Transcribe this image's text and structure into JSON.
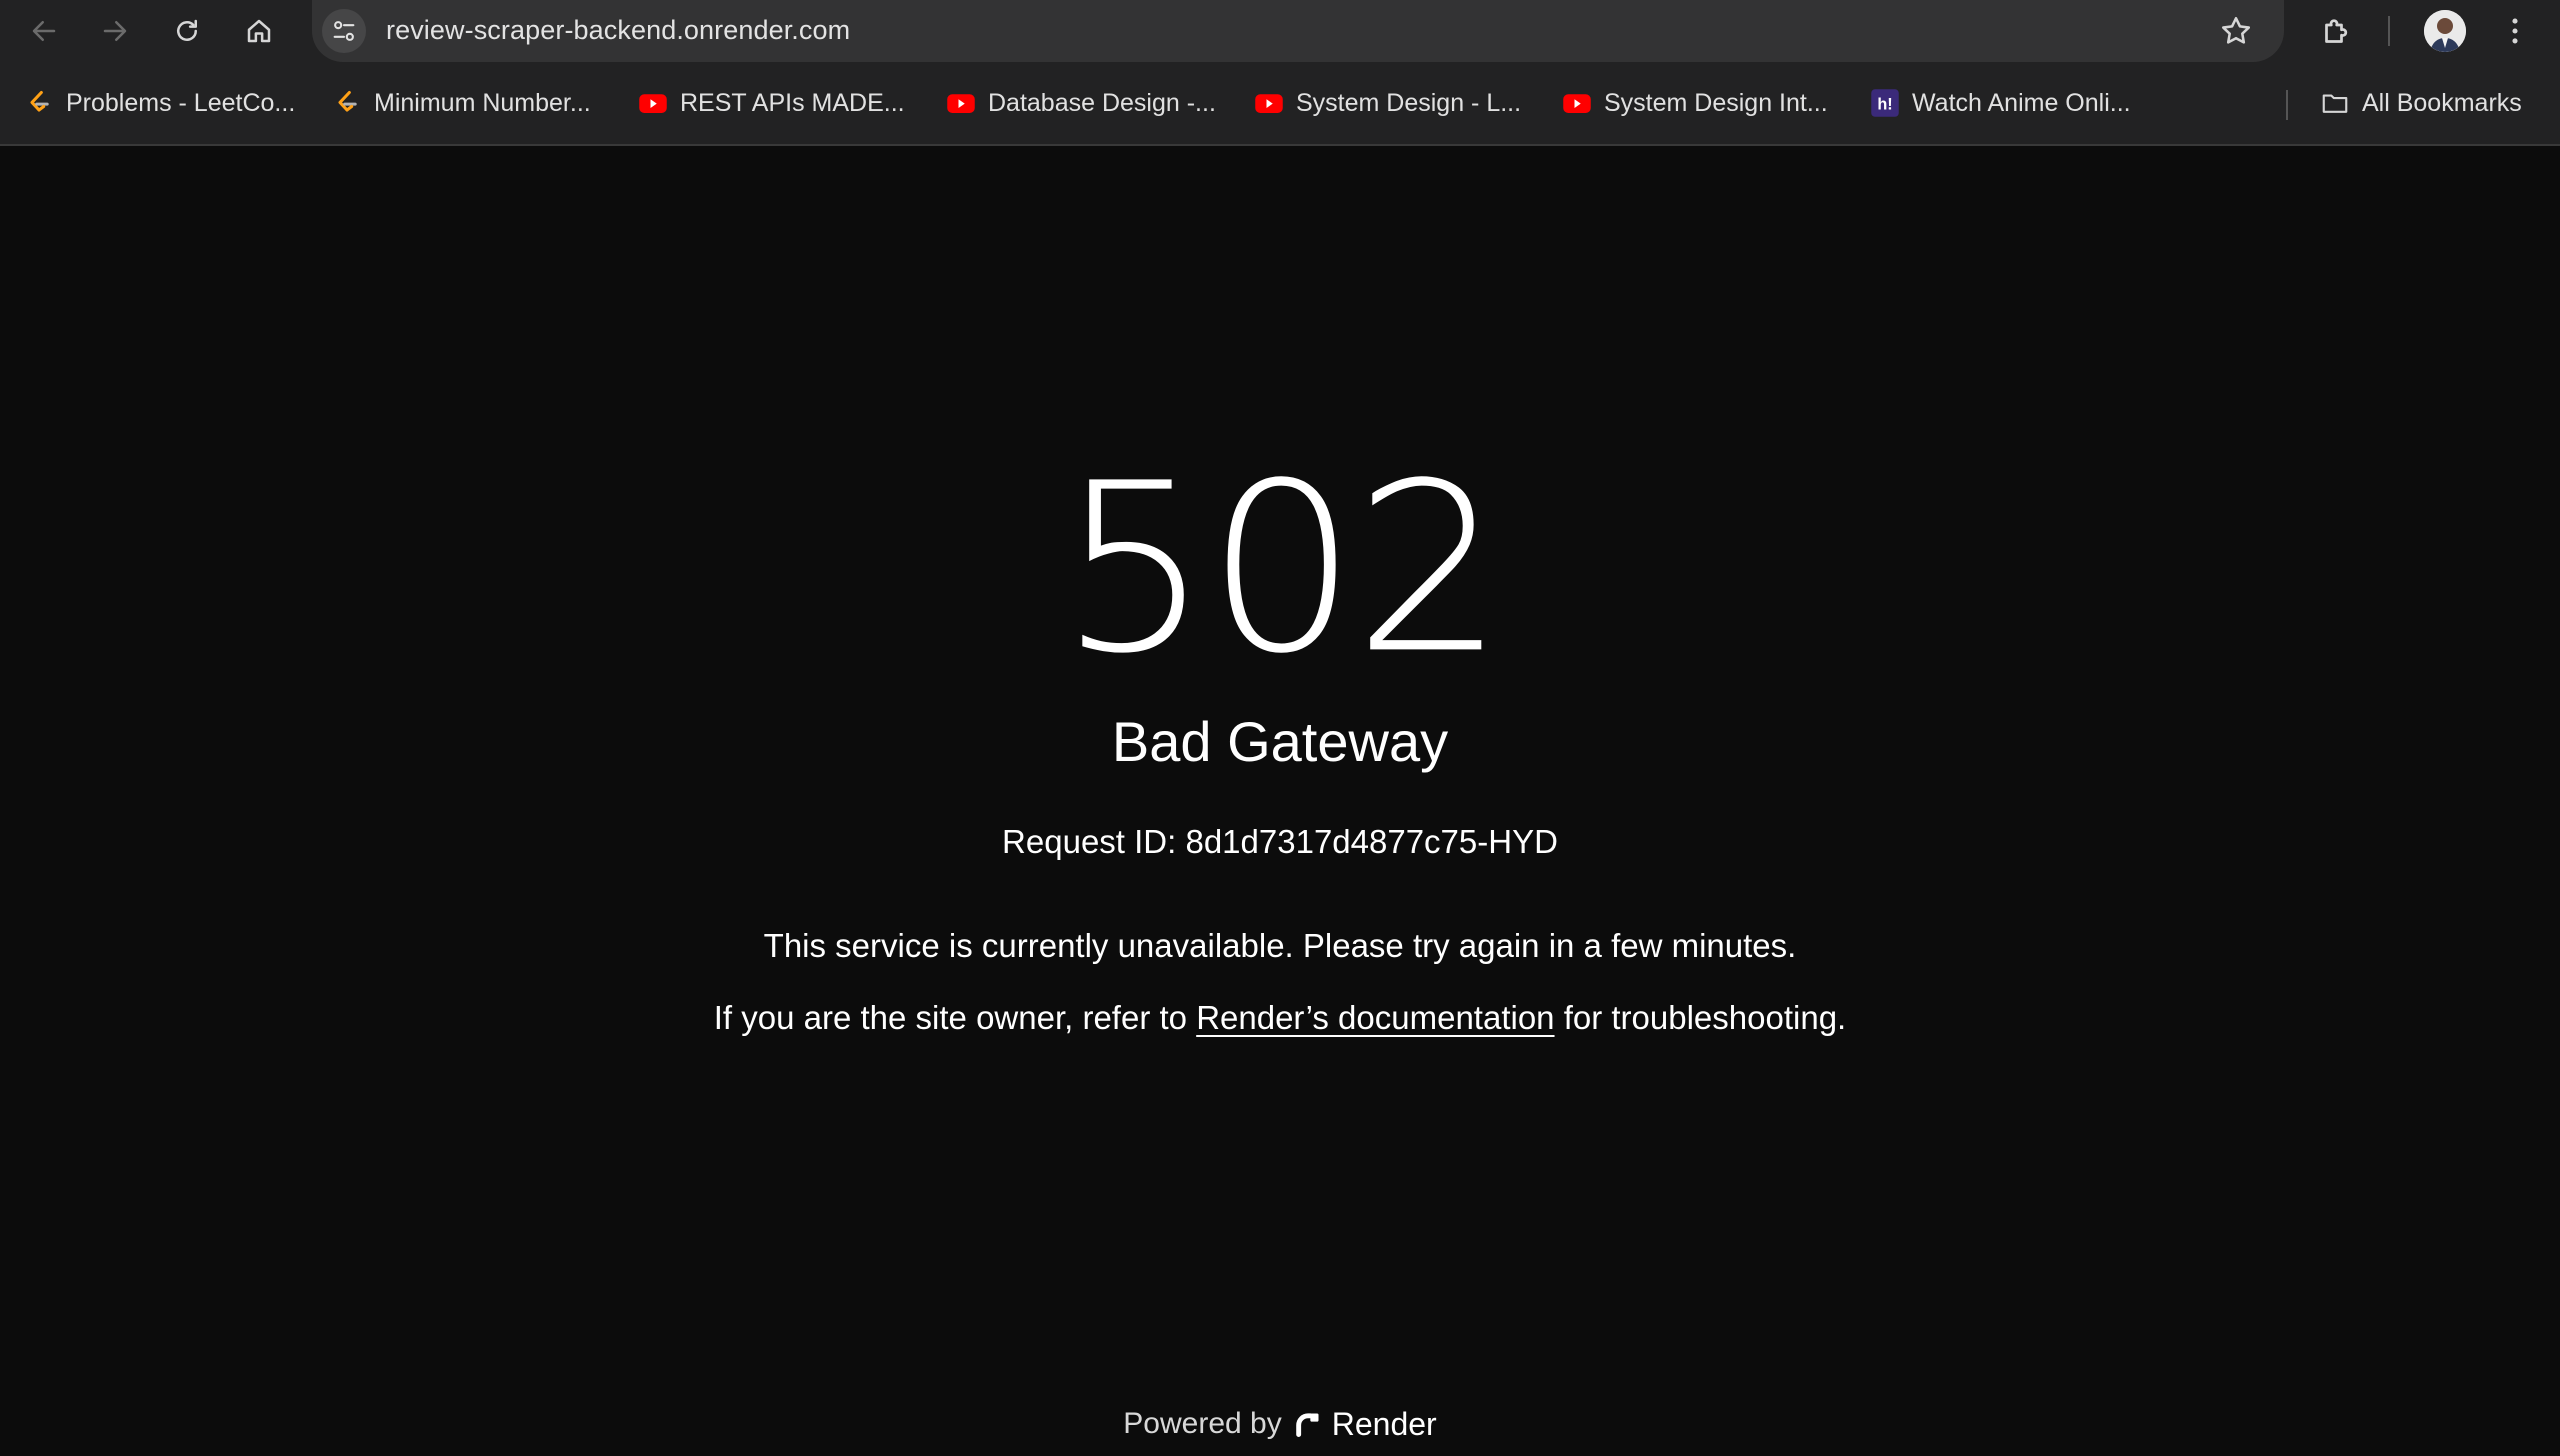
{
  "browser": {
    "url": "review-scraper-backend.onrender.com",
    "bookmarks": [
      {
        "label": "Problems - LeetCo...",
        "icon": "leetcode-icon"
      },
      {
        "label": "Minimum Number...",
        "icon": "leetcode-icon"
      },
      {
        "label": "REST APIs MADE...",
        "icon": "youtube-icon"
      },
      {
        "label": "Database Design -...",
        "icon": "youtube-icon"
      },
      {
        "label": "System Design - L...",
        "icon": "youtube-icon"
      },
      {
        "label": "System Design Int...",
        "icon": "youtube-icon"
      },
      {
        "label": "Watch Anime Onli...",
        "icon": "hianime-icon"
      }
    ],
    "all_bookmarks_label": "All Bookmarks"
  },
  "error": {
    "code": "502",
    "title": "Bad Gateway",
    "request_id_label": "Request ID:",
    "request_id": "8d1d7317d4877c75-HYD",
    "message": "This service is currently unavailable. Please try again in a few minutes.",
    "owner_prefix": "If you are the site owner, refer to",
    "docs_link": "Render’s documentation",
    "owner_suffix": "for troubleshooting."
  },
  "footer": {
    "powered_by": "Powered by",
    "brand": "Render"
  },
  "colors": {
    "page_bg": "#0c0c0c",
    "chrome_bg": "#222223",
    "omnibox_bg": "#333334",
    "youtube_red": "#ff0000",
    "leetcode_orange": "#ffa116"
  }
}
